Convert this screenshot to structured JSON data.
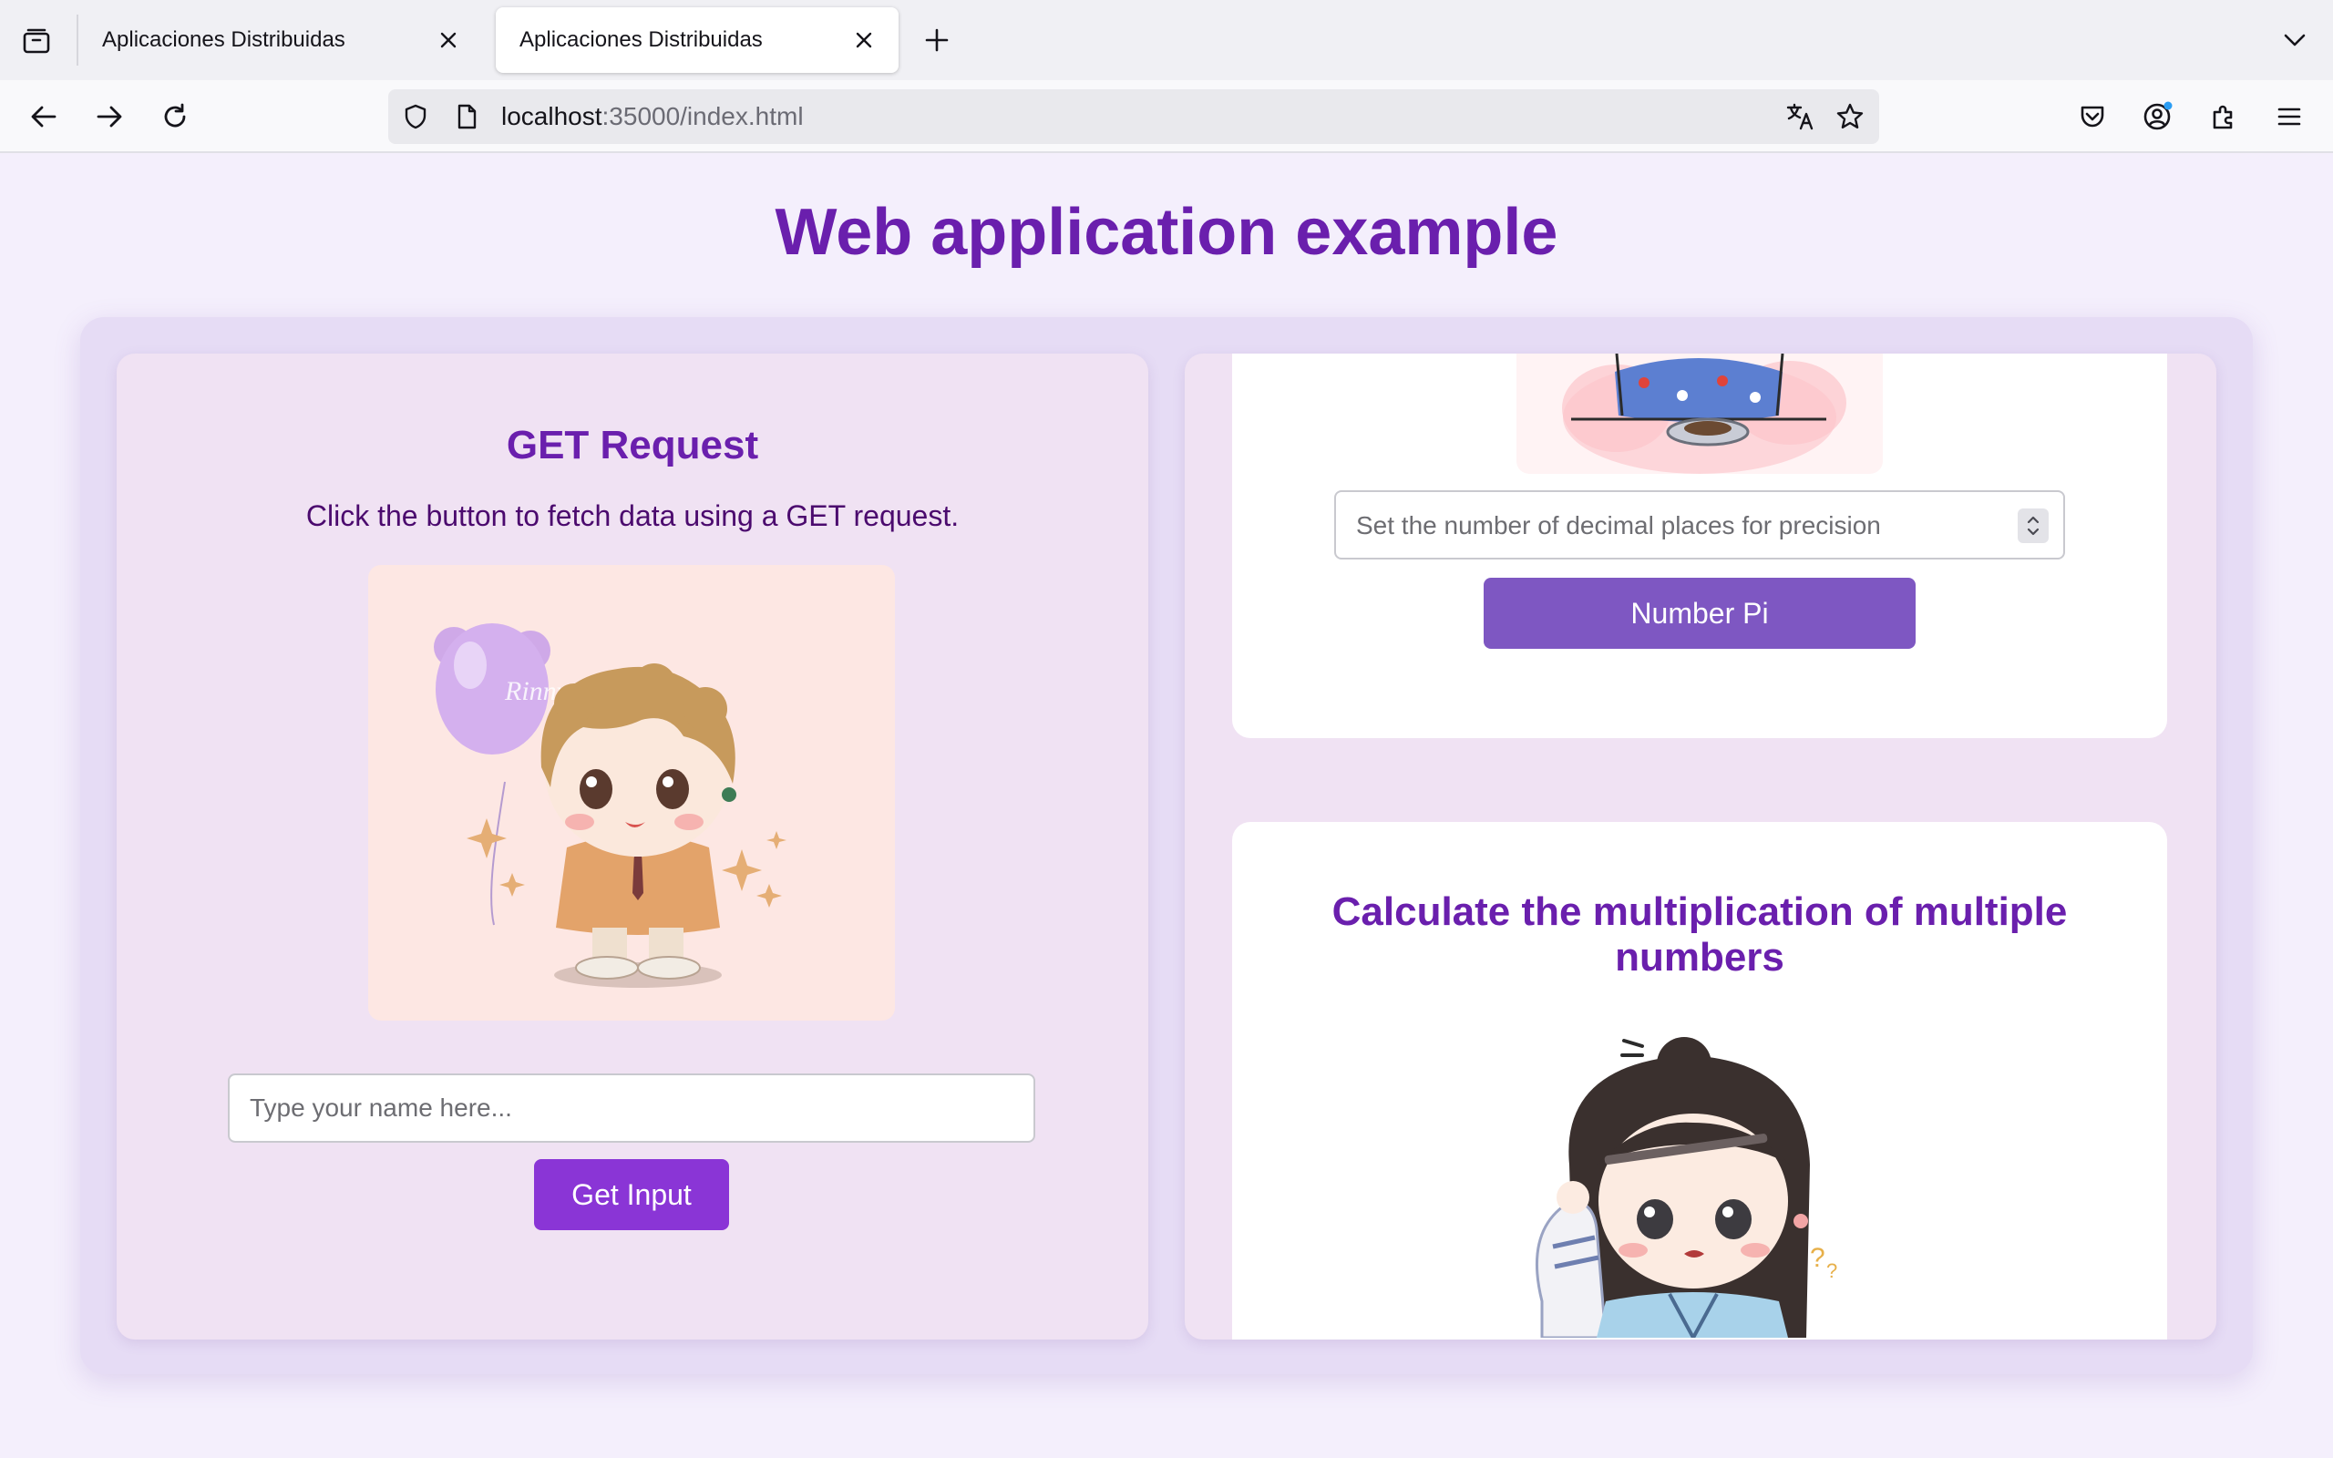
{
  "browser": {
    "tabs": [
      {
        "title": "Aplicaciones Distribuidas",
        "active": false
      },
      {
        "title": "Aplicaciones Distribuidas",
        "active": true
      }
    ],
    "url": {
      "host": "localhost",
      "path": ":35000/index.html"
    }
  },
  "page": {
    "title": "Web application example",
    "get_section": {
      "title": "GET Request",
      "description": "Click the button to fetch data using a GET request.",
      "image_watermark": "Rinny",
      "input_placeholder": "Type your name here...",
      "button_label": "Get Input"
    },
    "pi_section": {
      "input_placeholder": "Set the number of decimal places for precision",
      "button_label": "Number Pi"
    },
    "mult_section": {
      "title": "Calculate the multiplication of multiple numbers"
    }
  },
  "colors": {
    "accent": "#6a1fad",
    "get_button": "#8a35d6",
    "pi_button": "#7e57c2",
    "page_bg": "#f4effc"
  }
}
